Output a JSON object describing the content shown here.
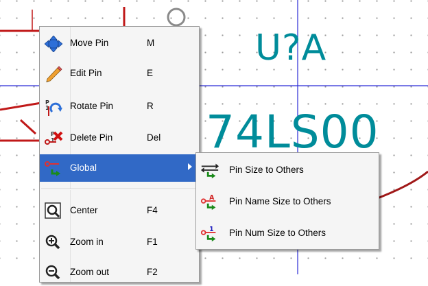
{
  "canvas": {
    "reference": "U?A",
    "value": "74LS00",
    "colors": {
      "text": "#008c9a",
      "wire": "#c01818",
      "grid_axis": "#2b2bd6",
      "grid_dot": "#9a9a9a"
    }
  },
  "context_menu": {
    "items": [
      {
        "label": "Move Pin",
        "shortcut": "M",
        "icon": "move-arrows-icon"
      },
      {
        "label": "Edit Pin",
        "shortcut": "E",
        "icon": "pencil-icon"
      },
      {
        "label": "Rotate Pin",
        "shortcut": "R",
        "icon": "rotate-pin-icon"
      },
      {
        "label": "Delete Pin",
        "shortcut": "Del",
        "icon": "delete-pin-icon"
      },
      {
        "label": "Global",
        "shortcut": "",
        "icon": "global-pin-icon",
        "highlighted": true,
        "has_submenu": true
      },
      {
        "label": "Center",
        "shortcut": "F4",
        "icon": "center-view-icon"
      },
      {
        "label": "Zoom in",
        "shortcut": "F1",
        "icon": "zoom-in-icon"
      },
      {
        "label": "Zoom out",
        "shortcut": "F2",
        "icon": "zoom-out-icon"
      }
    ],
    "highlight_color": "#3169c6"
  },
  "global_submenu": {
    "items": [
      {
        "label": "Pin Size to Others",
        "icon": "pin-size-icon"
      },
      {
        "label": "Pin Name Size to Others",
        "icon": "pin-name-size-icon"
      },
      {
        "label": "Pin Num Size to Others",
        "icon": "pin-num-size-icon"
      }
    ]
  }
}
